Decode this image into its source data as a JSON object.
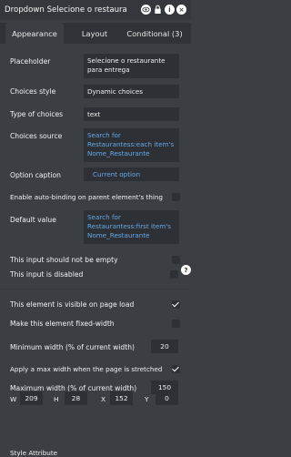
{
  "window": {
    "title": "Dropdown Selecione o restaura",
    "icons": [
      "eye-icon",
      "lock-icon",
      "info-icon",
      "delete-icon"
    ]
  },
  "tabs": [
    {
      "label": "Appearance",
      "active": true
    },
    {
      "label": "Layout",
      "active": false
    },
    {
      "label": "Conditional (3)",
      "active": false
    }
  ],
  "properties": {
    "placeholder": {
      "label": "Placeholder",
      "value_line1": "Selecione o restaurante",
      "value_line2": "para entrega"
    },
    "choices_style": {
      "label": "Choices style",
      "value": "Dynamic choices"
    },
    "type_of_choices": {
      "label": "Type of choices",
      "value": "text"
    },
    "choices_source": {
      "label": "Choices source",
      "line1": "Search for",
      "line2": "Restaurantess:each item's",
      "line3": "Nome_Restaurante"
    },
    "option_caption": {
      "label": "Option caption",
      "value": "Current option"
    },
    "auto_binding": {
      "label": "Enable auto-binding on parent element's thing",
      "checked": false
    },
    "default_value": {
      "label": "Default value",
      "line1": "Search for",
      "line2": "Restaurantess:first item's",
      "line3": "Nome_Restaurante"
    },
    "not_empty": {
      "label": "This input should not be empty",
      "checked": false
    },
    "disabled": {
      "label": "This input is disabled",
      "checked": false
    },
    "visible_on_load": {
      "label": "This element is visible on page load",
      "checked": true
    },
    "fixed_width": {
      "label": "Make this element fixed-width",
      "checked": false
    },
    "min_width": {
      "label": "Minimum width (% of current width)",
      "value": "20"
    },
    "apply_max_width": {
      "label": "Apply a max width when the page is stretched",
      "checked": true
    },
    "max_width": {
      "label": "Maximum width (% of current width)",
      "value": "150"
    }
  },
  "geometry": {
    "w_label": "W",
    "w_value": "209",
    "h_label": "H",
    "h_value": "28",
    "x_label": "X",
    "x_value": "152",
    "y_label": "Y",
    "y_value": "0"
  },
  "footer": {
    "style_attribute": "Style Attribute"
  },
  "help": {
    "label": "?"
  },
  "colors": {
    "accent_blue": "#67a9e8",
    "panel": "#3b3f44",
    "field": "#2d3034"
  }
}
